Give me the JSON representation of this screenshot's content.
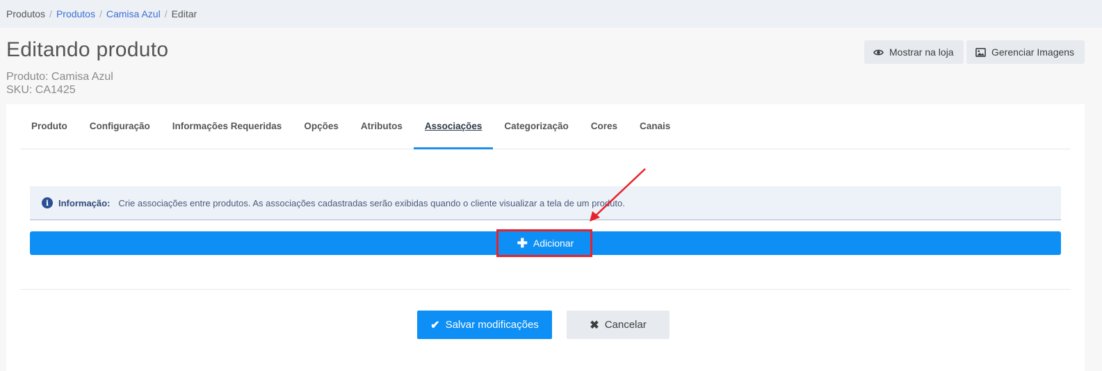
{
  "breadcrumb": {
    "items": [
      "Produtos",
      "Produtos",
      "Camisa Azul",
      "Editar"
    ],
    "separator": "/"
  },
  "header": {
    "title": "Editando produto",
    "product_line": "Produto: Camisa Azul",
    "sku_line": "SKU: CA1425",
    "show_in_store_label": "Mostrar na loja",
    "manage_images_label": "Gerenciar Imagens"
  },
  "tabs": [
    {
      "label": "Produto"
    },
    {
      "label": "Configuração"
    },
    {
      "label": "Informações Requeridas"
    },
    {
      "label": "Opções"
    },
    {
      "label": "Atributos"
    },
    {
      "label": "Associações",
      "active": true
    },
    {
      "label": "Categorização"
    },
    {
      "label": "Cores"
    },
    {
      "label": "Canais"
    }
  ],
  "info": {
    "label": "Informação:",
    "text": "Crie associações entre produtos. As associações cadastradas serão exibidas quando o cliente visualizar a tela de um produto."
  },
  "add": {
    "label": "Adicionar",
    "icon": "plus-icon"
  },
  "footer": {
    "save_label": "Salvar modificações",
    "cancel_label": "Cancelar"
  },
  "colors": {
    "primary": "#0d8ff5",
    "highlight": "#e8222a",
    "info_bg": "#edf1f8"
  }
}
